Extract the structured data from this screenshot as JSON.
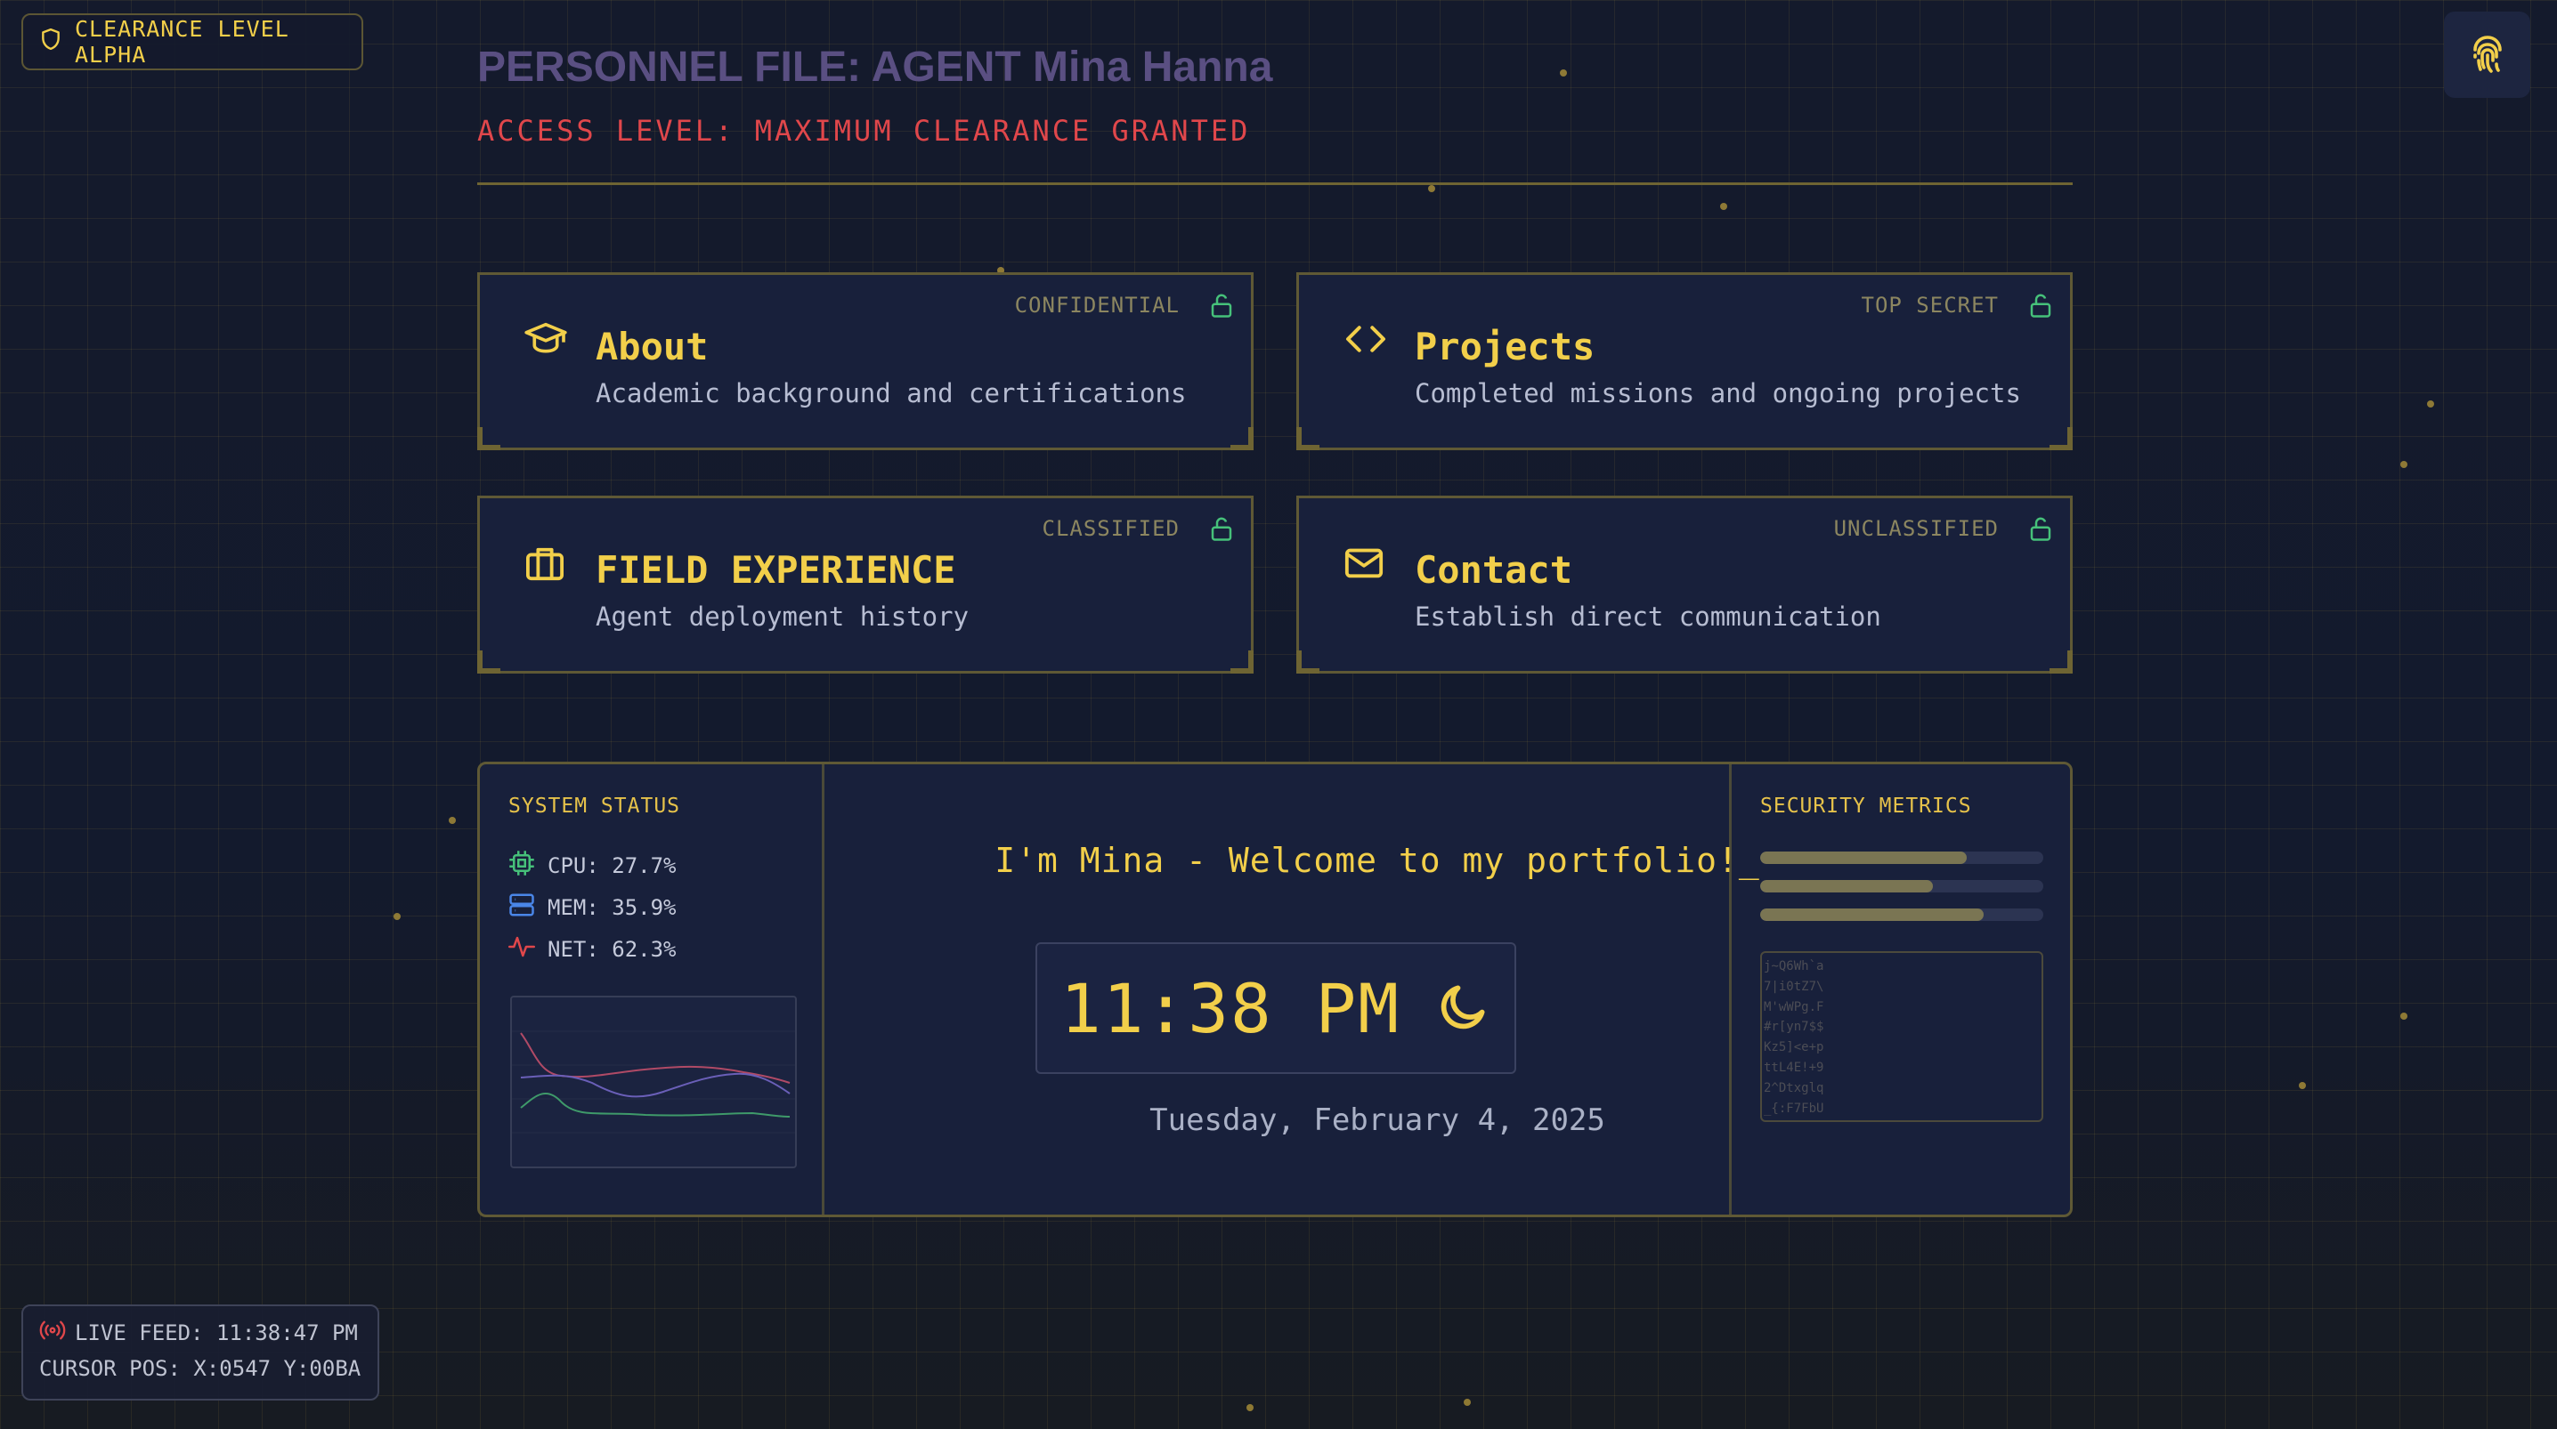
{
  "badge": {
    "label": "CLEARANCE LEVEL ALPHA",
    "icon": "shield-icon"
  },
  "fingerprint_button": {
    "icon": "fingerprint-icon"
  },
  "header": {
    "title": "PERSONNEL FILE: AGENT Mina Hanna",
    "subtitle": "ACCESS LEVEL: MAXIMUM CLEARANCE GRANTED"
  },
  "cards": [
    {
      "title": "About",
      "description": "Academic background and certifications",
      "level": "CONFIDENTIAL",
      "icon": "graduation-cap-icon"
    },
    {
      "title": "Projects",
      "description": "Completed missions and ongoing projects",
      "level": "TOP SECRET",
      "icon": "code-icon"
    },
    {
      "title": "FIELD EXPERIENCE",
      "description": "Agent deployment history",
      "level": "CLASSIFIED",
      "icon": "briefcase-icon"
    },
    {
      "title": "Contact",
      "description": "Establish direct communication",
      "level": "UNCLASSIFIED",
      "icon": "mail-icon"
    }
  ],
  "system_status": {
    "heading": "SYSTEM STATUS",
    "cpu": "CPU: 27.7%",
    "mem": "MEM: 35.9%",
    "net": "NET: 62.3%"
  },
  "center": {
    "welcome": "I'm Mina - Welcome to my portfolio!_",
    "time": "11:38 PM",
    "date": "Tuesday, February 4, 2025"
  },
  "security": {
    "heading": "SECURITY METRICS",
    "levels": [
      0.73,
      0.61,
      0.79
    ],
    "log_lines": [
      "j~Q6Wh`a",
      "7|i0tZ7\\",
      "M'wWPg.F",
      "#r[yn7$$",
      "Kz5]<e+p",
      "ttL4E!+9",
      "2^Dtxglq",
      "_{:F7FbU"
    ]
  },
  "live_feed": {
    "label": "LIVE FEED: 11:38:47 PM",
    "cursor": "CURSOR POS: X:0547 Y:00BA"
  },
  "colors": {
    "accent": "#f2cf4a",
    "alert": "#e0474b",
    "success": "#46c17a",
    "info": "#4a86e8",
    "title": "#5a4f82"
  }
}
